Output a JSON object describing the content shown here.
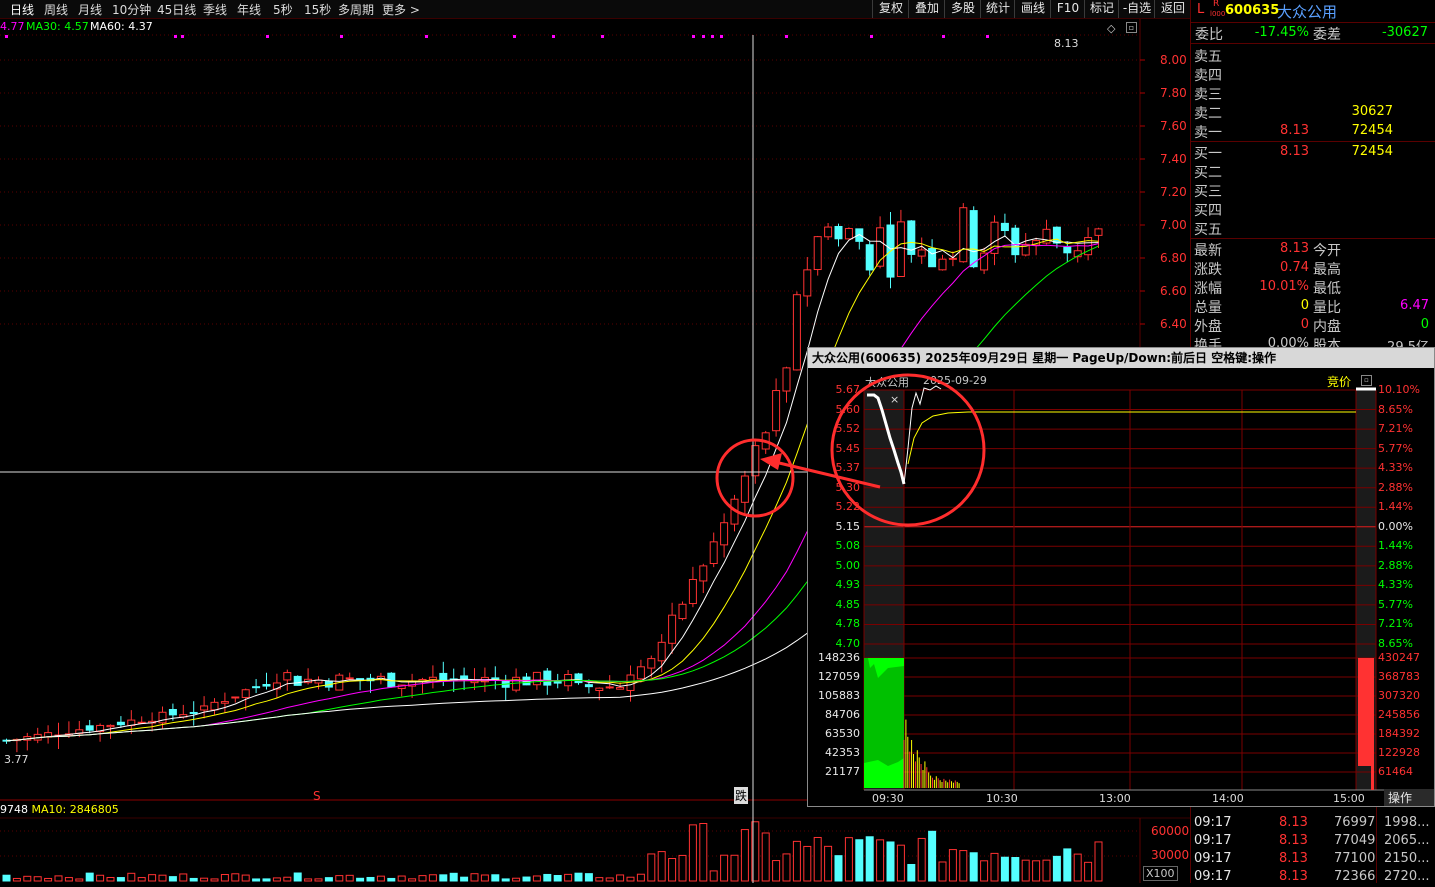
{
  "toolbar": {
    "periods": [
      "日线",
      "周线",
      "月线",
      "10分钟",
      "45日线",
      "季线",
      "年线",
      "5秒",
      "15秒",
      "多周期",
      "更多 >"
    ],
    "right_buttons": [
      "复权",
      "叠加",
      "多股",
      "统计",
      "画线",
      "F10",
      "标记",
      "-自选",
      "返回"
    ]
  },
  "ma_legend": {
    "ma20_cut": "4.77",
    "ma30": "MA30: 4.57",
    "ma60": "MA60: 4.37"
  },
  "vol_legend": {
    "cut": "9748",
    "ma10": "MA10: 2846805"
  },
  "price_axis": [
    "8.00",
    "7.80",
    "7.60",
    "7.40",
    "7.20",
    "7.00",
    "6.80",
    "6.60",
    "6.40"
  ],
  "vol_axis": [
    "60000",
    "30000"
  ],
  "vol_unit": "X100",
  "annotations": {
    "top_price": "8.13",
    "low_price": "3.77",
    "marker_s": "S",
    "marker_fall": "跌"
  },
  "stock": {
    "tag_l": "L",
    "tag_r": "R",
    "tag_level": "l000",
    "code": "600635",
    "name": "大众公用"
  },
  "order": {
    "weibi_label": "委比",
    "weibi": "-17.45%",
    "weicha_label": "委差",
    "weicha": "-30627",
    "sells": [
      {
        "label": "卖五",
        "price": "",
        "vol": ""
      },
      {
        "label": "卖四",
        "price": "",
        "vol": ""
      },
      {
        "label": "卖三",
        "price": "",
        "vol": ""
      },
      {
        "label": "卖二",
        "price": "",
        "vol": "30627"
      },
      {
        "label": "卖一",
        "price": "8.13",
        "vol": "72454"
      }
    ],
    "buys": [
      {
        "label": "买一",
        "price": "8.13",
        "vol": "72454"
      },
      {
        "label": "买二",
        "price": "",
        "vol": ""
      },
      {
        "label": "买三",
        "price": "",
        "vol": ""
      },
      {
        "label": "买四",
        "price": "",
        "vol": ""
      },
      {
        "label": "买五",
        "price": "",
        "vol": ""
      }
    ]
  },
  "quote": [
    {
      "l": "最新",
      "v": "8.13",
      "l2": "今开",
      "v2": ""
    },
    {
      "l": "涨跌",
      "v": "0.74",
      "l2": "最高",
      "v2": ""
    },
    {
      "l": "涨幅",
      "v": "10.01%",
      "l2": "最低",
      "v2": ""
    },
    {
      "l": "总量",
      "v": "0",
      "l2": "量比",
      "v2": "6.47"
    },
    {
      "l": "外盘",
      "v": "0",
      "l2": "内盘",
      "v2": "0"
    },
    {
      "l": "换手",
      "v": "0.00%",
      "l2": "股本",
      "v2": "29.5亿"
    }
  ],
  "ticks": [
    {
      "t": "09:17",
      "p": "8.13",
      "v": "76997",
      "x": "1998..."
    },
    {
      "t": "09:17",
      "p": "8.13",
      "v": "77049",
      "x": "2065..."
    },
    {
      "t": "09:17",
      "p": "8.13",
      "v": "77100",
      "x": "2150..."
    },
    {
      "t": "09:17",
      "p": "8.13",
      "v": "72366",
      "x": "2720..."
    }
  ],
  "popup": {
    "header": "大众公用(600635)  2025年09月29日 星期一  PageUp/Down:前后日 空格键:操作",
    "title": "大众公用",
    "date": "2025-09-29",
    "auction_label": "竞价",
    "close_glyph": "×",
    "prices": [
      "5.67",
      "5.60",
      "5.52",
      "5.45",
      "5.37",
      "5.30",
      "5.22",
      "5.15",
      "5.08",
      "5.00",
      "4.93",
      "4.85",
      "4.78",
      "4.70"
    ],
    "pcts_up": [
      "10.10%",
      "8.65%",
      "7.21%",
      "5.77%",
      "4.33%",
      "2.88%",
      "1.44%",
      "0.00%"
    ],
    "pcts_down": [
      "1.44%",
      "2.88%",
      "4.33%",
      "5.77%",
      "7.21%",
      "8.65%"
    ],
    "vol_left": [
      "148236",
      "127059",
      "105883",
      "84706",
      "63530",
      "42353",
      "21177"
    ],
    "vol_right": [
      "430247",
      "368783",
      "307320",
      "245856",
      "184392",
      "122928",
      "61464"
    ],
    "times": [
      "09:30",
      "10:30",
      "13:00",
      "14:00",
      "15:00"
    ],
    "action": "操作"
  },
  "colors": {
    "up": "#ff3232",
    "down": "#54ffff",
    "ma5": "#ffffff",
    "ma10": "#ffff00",
    "ma20": "#ff00ff",
    "ma30": "#00ff00",
    "ma60": "#ffffff",
    "highlight": "#ff2d2d"
  }
}
